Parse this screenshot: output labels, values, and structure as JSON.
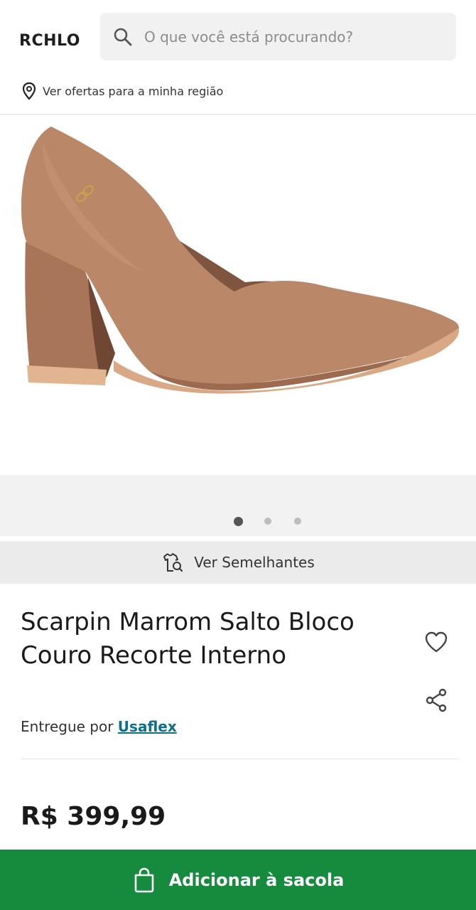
{
  "header": {
    "logo": "RCHLO",
    "search": {
      "placeholder": "O que você está procurando?",
      "value": ""
    },
    "region_link": "Ver ofertas para a minha região"
  },
  "gallery": {
    "image_count": 3,
    "active_index": 0,
    "colors": {
      "shoe": "#b98668",
      "shoe_dark": "#9a6b50",
      "sole": "#e1b58f"
    }
  },
  "similar": {
    "label": "Ver Semelhantes"
  },
  "product": {
    "title": "Scarpin Marrom Salto Bloco Couro Recorte Interno",
    "delivered_by_prefix": "Entregue por",
    "seller": "Usaflex",
    "price": "R$ 399,99"
  },
  "actions": {
    "add_to_bag": "Adicionar à sacola",
    "primary_color": "#168a3d"
  }
}
